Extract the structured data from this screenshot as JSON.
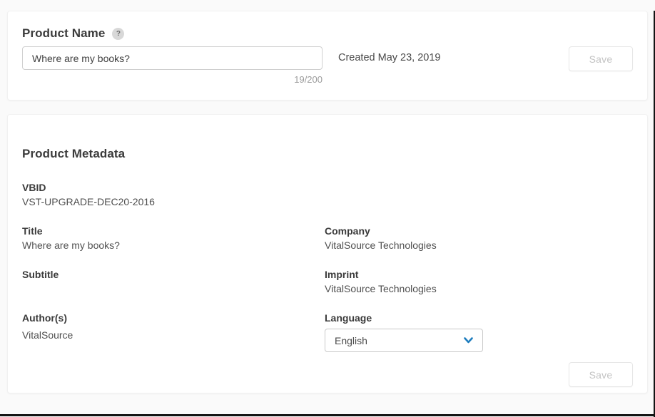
{
  "page": {
    "background_color": "#fafafa",
    "accent_blue": "#1e7dbe",
    "help_glyph": "?"
  },
  "product_name_card": {
    "title": "Product Name",
    "name_input": {
      "value": "Where are my books?",
      "placeholder": ""
    },
    "char_counter": "19/200",
    "created_text": "Created May 23, 2019",
    "save_label": "Save"
  },
  "metadata_card": {
    "title": "Product Metadata",
    "fields": {
      "vbid": {
        "label": "VBID",
        "value": "VST-UPGRADE-DEC20-2016"
      },
      "title": {
        "label": "Title",
        "value": "Where are my books?"
      },
      "company": {
        "label": "Company",
        "value": "VitalSource Technologies"
      },
      "subtitle": {
        "label": "Subtitle",
        "value": ""
      },
      "imprint": {
        "label": "Imprint",
        "value": "VitalSource Technologies"
      },
      "authors": {
        "label": "Author(s)",
        "value": "VitalSource"
      },
      "language": {
        "label": "Language",
        "selected": "English"
      }
    },
    "save_label": "Save"
  }
}
